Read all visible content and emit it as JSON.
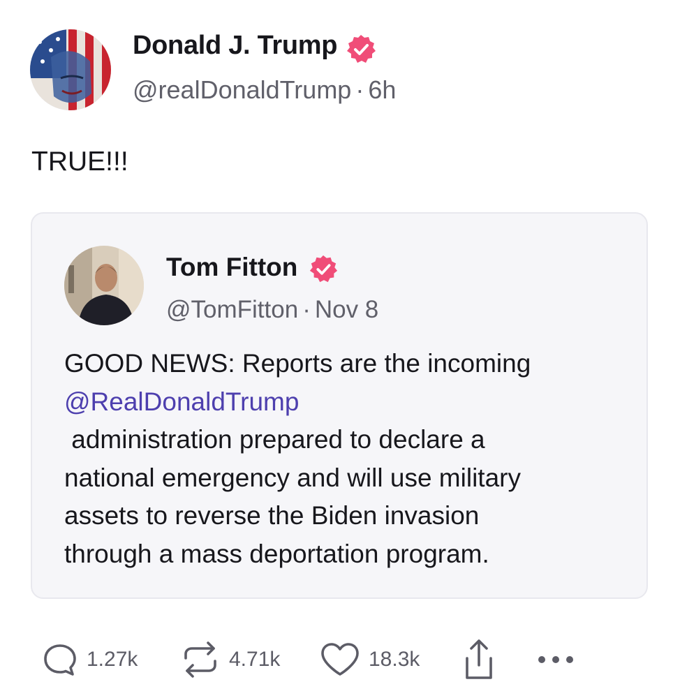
{
  "post": {
    "author_name": "Donald J. Trump",
    "author_handle": "@realDonaldTrump",
    "separator": "·",
    "time": "6h",
    "text": "TRUE!!!"
  },
  "quote": {
    "author_name": "Tom Fitton",
    "author_handle": "@TomFitton",
    "separator": "·",
    "date": "Nov 8",
    "line1": "GOOD NEWS: Reports are the incoming",
    "mention": "@RealDonaldTrump",
    "line3": " administration prepared to declare a",
    "line4": "national emergency and will use military",
    "line5": "assets to reverse the Biden invasion",
    "line6": "through a mass deportation program."
  },
  "actions": {
    "replies": "1.27k",
    "reposts": "4.71k",
    "likes": "18.3k"
  },
  "colors": {
    "verified_badge": "#f04d78",
    "mention": "#4d3fae",
    "muted_text": "#60606a"
  },
  "icons": [
    "verified-badge-icon",
    "reply-icon",
    "repost-icon",
    "like-icon",
    "share-icon",
    "more-icon"
  ]
}
